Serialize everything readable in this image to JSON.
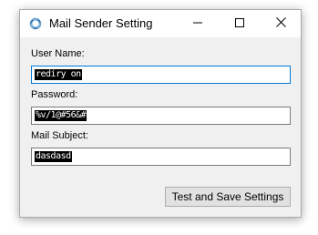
{
  "window": {
    "title": "Mail Sender Setting",
    "icon": "app-ring-icon",
    "controls": [
      "minimize-icon",
      "maximize-icon",
      "close-icon"
    ]
  },
  "form": {
    "username": {
      "label": "User Name:",
      "value": "rediry on"
    },
    "password": {
      "label": "Password:",
      "value": "%v/1@#56&#"
    },
    "subject": {
      "label": "Mail Subject:",
      "value": "dasdasd"
    }
  },
  "actions": {
    "test_save_label": "Test and Save Settings"
  },
  "colors": {
    "window_bg": "#f0f0f0",
    "focus_border": "#0078d7",
    "selection_bg": "#000000",
    "button_bg": "#e1e1e1"
  }
}
